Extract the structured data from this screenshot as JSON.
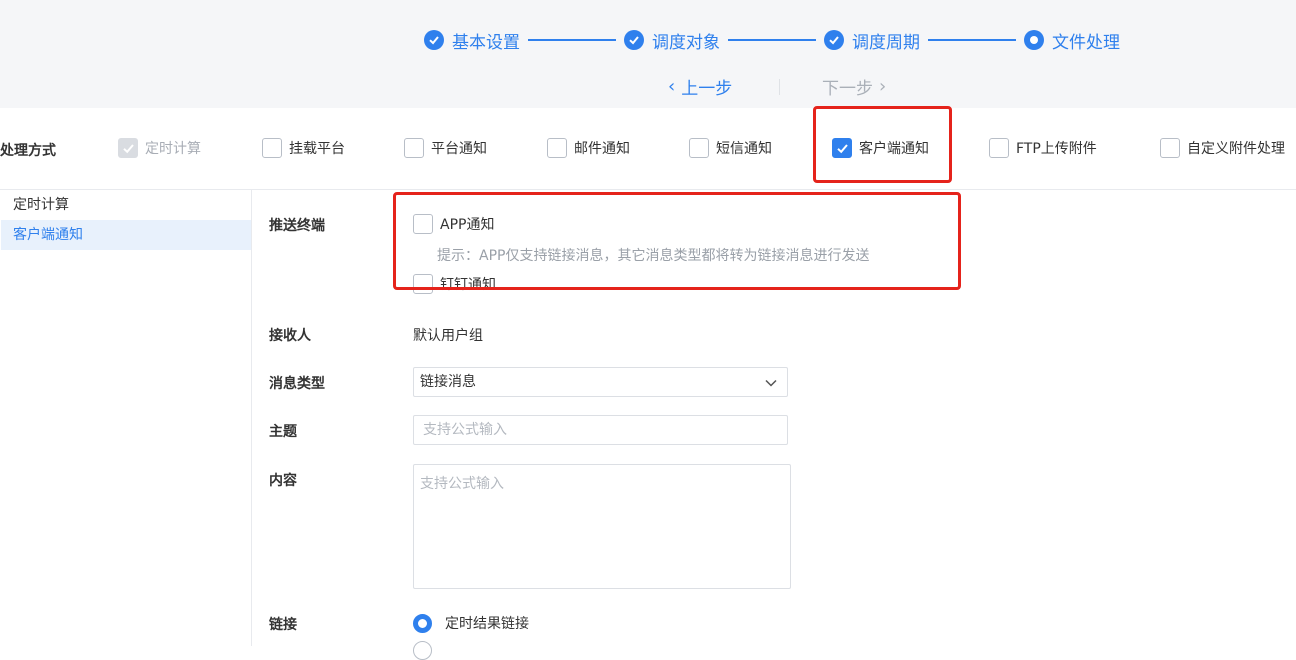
{
  "wizard": {
    "steps": [
      {
        "label": "基本设置",
        "state": "done"
      },
      {
        "label": "调度对象",
        "state": "done"
      },
      {
        "label": "调度周期",
        "state": "done"
      },
      {
        "label": "文件处理",
        "state": "current"
      }
    ],
    "prev_label": "上一步",
    "next_label": "下一步"
  },
  "methods": {
    "label": "处理方式",
    "options": [
      {
        "label": "定时计算",
        "checked": true,
        "disabled": true
      },
      {
        "label": "挂载平台",
        "checked": false
      },
      {
        "label": "平台通知",
        "checked": false
      },
      {
        "label": "邮件通知",
        "checked": false
      },
      {
        "label": "短信通知",
        "checked": false
      },
      {
        "label": "客户端通知",
        "checked": true
      },
      {
        "label": "FTP上传附件",
        "checked": false
      },
      {
        "label": "自定义附件处理",
        "checked": false
      }
    ]
  },
  "sidebar": {
    "items": [
      {
        "label": "定时计算",
        "active": false
      },
      {
        "label": "客户端通知",
        "active": true
      }
    ]
  },
  "form": {
    "push_label": "推送终端",
    "app_notify": "APP通知",
    "app_hint": "提示：APP仅支持链接消息，其它消息类型都将转为链接消息进行发送",
    "dingtalk_notify": "钉钉通知",
    "receiver_label": "接收人",
    "receiver_value": "默认用户组",
    "msg_type_label": "消息类型",
    "msg_type_value": "链接消息",
    "subject_label": "主题",
    "subject_placeholder": "支持公式输入",
    "content_label": "内容",
    "content_placeholder": "支持公式输入",
    "link_label": "链接",
    "link_option_1": "定时结果链接"
  },
  "colors": {
    "accent": "#2f80ed",
    "highlight": "#e5231b"
  }
}
